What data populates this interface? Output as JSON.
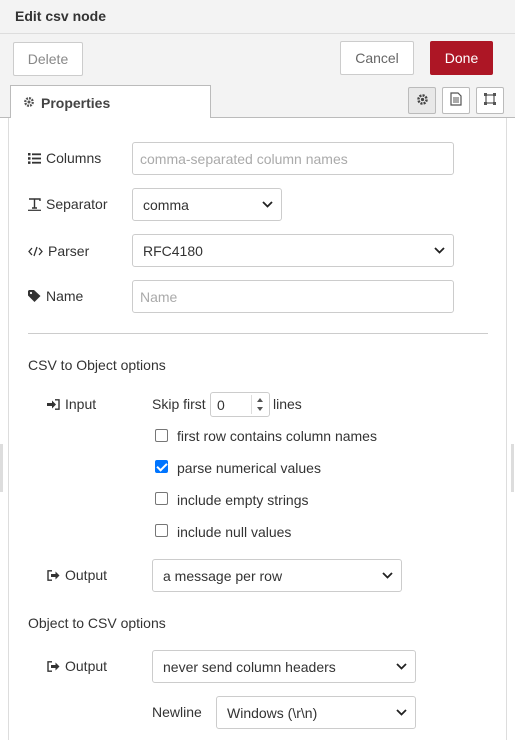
{
  "header": {
    "title": "Edit csv node"
  },
  "toolbar": {
    "delete_label": "Delete",
    "cancel_label": "Cancel",
    "done_label": "Done",
    "done_color": "#ad1625"
  },
  "tabs": {
    "properties_label": "Properties"
  },
  "form": {
    "columns": {
      "label": "Columns",
      "placeholder": "comma-separated column names"
    },
    "separator": {
      "label": "Separator",
      "value": "comma"
    },
    "parser": {
      "label": "Parser",
      "value": "RFC4180"
    },
    "name": {
      "label": "Name",
      "placeholder": "Name"
    }
  },
  "csv_to_object": {
    "title": "CSV to Object options",
    "input_label": "Input",
    "skip_first_label": "Skip first",
    "skip_value": "0",
    "lines_label": "lines",
    "checkboxes": [
      {
        "label": "first row contains column names",
        "checked": false
      },
      {
        "label": "parse numerical values",
        "checked": true
      },
      {
        "label": "include empty strings",
        "checked": false
      },
      {
        "label": "include null values",
        "checked": false
      }
    ],
    "output_label": "Output",
    "output_value": "a message per row"
  },
  "object_to_csv": {
    "title": "Object to CSV options",
    "output_label": "Output",
    "output_value": "never send column headers",
    "newline_label": "Newline",
    "newline_value": "Windows (\\r\\n)"
  },
  "icons": [
    "gear-icon",
    "document-icon",
    "frame-icon",
    "list-icon",
    "text-icon",
    "code-icon",
    "tag-icon",
    "sign-in-icon",
    "sign-out-icon"
  ]
}
